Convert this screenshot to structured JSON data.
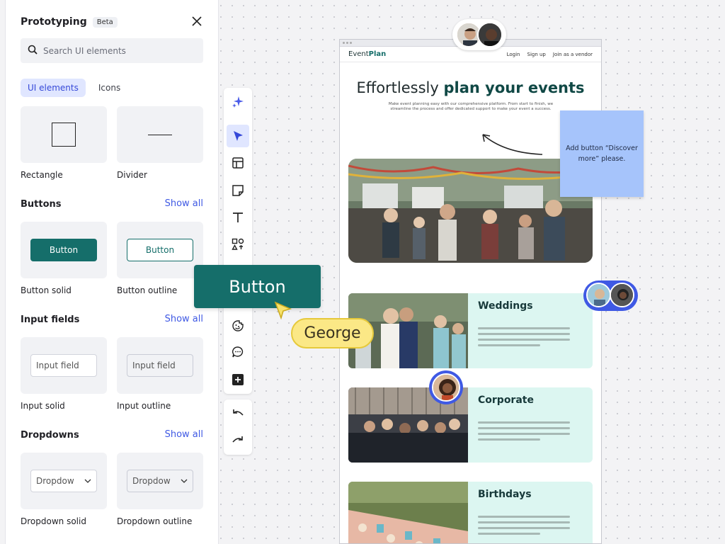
{
  "panel": {
    "title": "Prototyping",
    "badge": "Beta",
    "search_placeholder": "Search UI elements",
    "tabs": [
      {
        "label": "UI elements",
        "active": true
      },
      {
        "label": "Icons",
        "active": false
      }
    ],
    "shapes": [
      {
        "label": "Rectangle"
      },
      {
        "label": "Divider"
      }
    ],
    "sections": {
      "buttons": {
        "title": "Buttons",
        "show_all": "Show all",
        "items": [
          {
            "preview": "Button",
            "label": "Button solid"
          },
          {
            "preview": "Button",
            "label": "Button outline"
          }
        ]
      },
      "inputs": {
        "title": "Input fields",
        "show_all": "Show all",
        "items": [
          {
            "preview": "Input field",
            "label": "Input solid"
          },
          {
            "preview": "Input field",
            "label": "Input outline"
          }
        ]
      },
      "dropdowns": {
        "title": "Dropdowns",
        "show_all": "Show all",
        "items": [
          {
            "preview": "Dropdow",
            "label": "Dropdown solid"
          },
          {
            "preview": "Dropdow",
            "label": "Dropdown outline"
          }
        ]
      }
    }
  },
  "toolbar": {
    "tools": [
      "ai-sparkle-icon",
      "select-cursor-icon",
      "layout-icon",
      "sticky-note-icon",
      "text-icon",
      "shapes-icon",
      "emoji-icon",
      "comment-icon",
      "add-icon",
      "undo-icon",
      "redo-icon"
    ]
  },
  "canvas": {
    "dragged_button_label": "Button",
    "cursor_name": "George",
    "cursor_color": "#fbe886",
    "sticky_note": "Add button “Discover more” please."
  },
  "frame": {
    "logo_prefix": "Event",
    "logo_suffix": "Plan",
    "nav_links": [
      "Login",
      "Sign up",
      "Join as a vendor"
    ],
    "hero_title_plain": "Effortlessly ",
    "hero_title_bold": "plan your events",
    "hero_subtitle": "Make event planning easy with our comprehensive platform. From start to finish, we streamline the process and offer dedicated support to make your event a success.",
    "categories": [
      {
        "title": "Weddings"
      },
      {
        "title": "Corporate"
      },
      {
        "title": "Birthdays"
      }
    ]
  },
  "colors": {
    "primary": "#156e6a",
    "accent_blue": "#3f59e4",
    "card_bg": "#dcf6f1",
    "sticky_bg": "#a6c4fb"
  }
}
